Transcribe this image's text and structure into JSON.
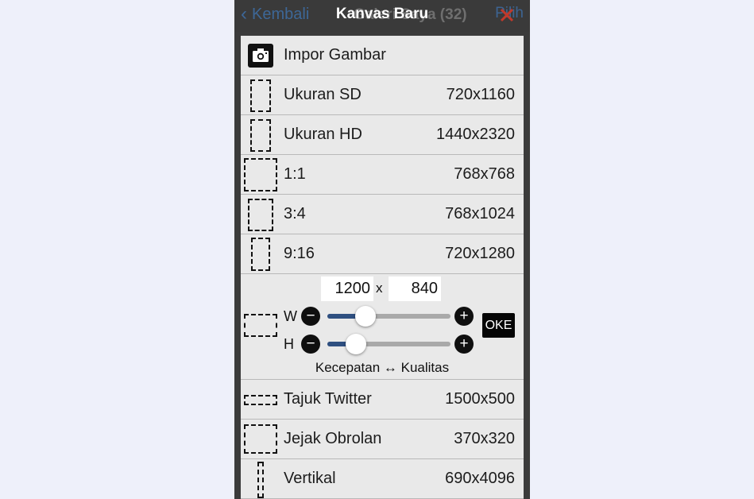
{
  "topbar": {
    "back_label": "Kembali",
    "ghost_title": "Galeri Saya (32)",
    "title": "Kanvas Baru",
    "right_label": "Pilih"
  },
  "import": {
    "label": "Impor Gambar",
    "icon": "camera-icon"
  },
  "presets": [
    {
      "label": "Ukuran SD",
      "size": "720x1160"
    },
    {
      "label": "Ukuran HD",
      "size": "1440x2320"
    },
    {
      "label": "1:1",
      "size": "768x768"
    },
    {
      "label": "3:4",
      "size": "768x1024"
    },
    {
      "label": "9:16",
      "size": "720x1280"
    }
  ],
  "custom": {
    "width_value": "1200",
    "separator": "x",
    "height_value": "840",
    "w_label": "W",
    "h_label": "H",
    "minus": "−",
    "plus": "+",
    "ok_label": "OKE",
    "tradeoff_label": "Kecepatan ↔ Kualitas",
    "w_slider_fraction": 0.31,
    "h_slider_fraction": 0.23
  },
  "more_presets": [
    {
      "label": "Tajuk Twitter",
      "size": "1500x500"
    },
    {
      "label": "Jejak Obrolan",
      "size": "370x320"
    },
    {
      "label": "Vertikal",
      "size": "690x4096"
    }
  ],
  "colors": {
    "accent": "#2e4f80",
    "link": "#3e6fa8",
    "close_red": "#c0392b"
  }
}
